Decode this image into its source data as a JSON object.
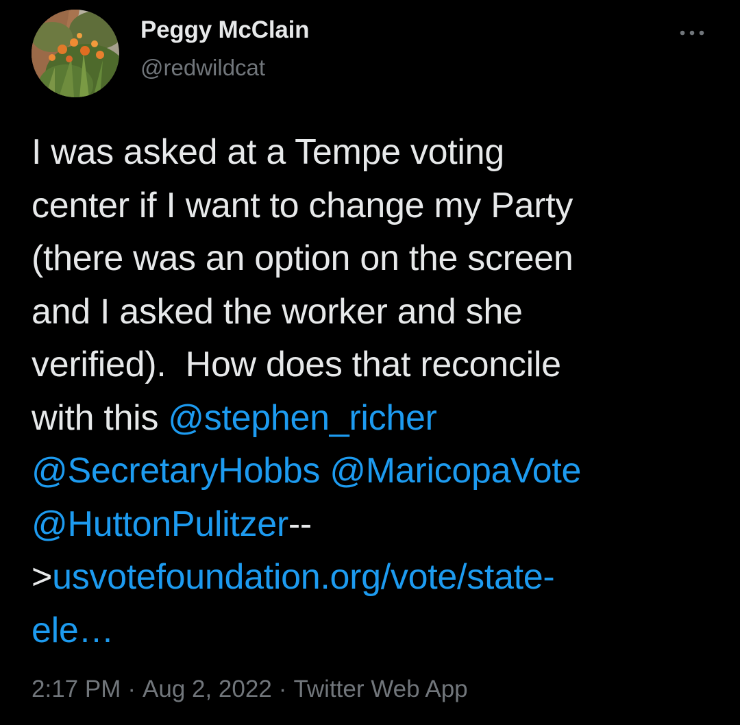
{
  "user": {
    "display_name": "Peggy McClain",
    "handle": "@redwildcat",
    "avatar_icon": "garden-flowers-avatar"
  },
  "menu": {
    "icon": "more-horizontal-icon"
  },
  "tweet": {
    "lines": [
      [
        {
          "text": "I was asked at a Tempe voting"
        }
      ],
      [
        {
          "text": "center if I want to change my Party"
        }
      ],
      [
        {
          "text": "(there was an option on the screen"
        }
      ],
      [
        {
          "text": "and I asked the worker and she"
        }
      ],
      [
        {
          "text": "verified).  How does that reconcile"
        }
      ],
      [
        {
          "text": "with this "
        },
        {
          "text": "@stephen_richer",
          "link": true
        }
      ],
      [
        {
          "text": "@SecretaryHobbs",
          "link": true
        },
        {
          "text": " "
        },
        {
          "text": "@MaricopaVote",
          "link": true
        }
      ],
      [
        {
          "text": "@HuttonPulitzer",
          "link": true
        },
        {
          "text": "--"
        }
      ],
      [
        {
          "text": ">"
        },
        {
          "text": "usvotefoundation.org/vote/state-",
          "link": true
        }
      ],
      [
        {
          "text": "ele…",
          "link": true
        }
      ]
    ]
  },
  "meta": {
    "time": "2:17 PM",
    "separator": "·",
    "date": "Aug 2, 2022",
    "source": "Twitter Web App"
  },
  "colors": {
    "background": "#000000",
    "text": "#e7e9ea",
    "secondary": "#71767b",
    "link": "#1d9bf0"
  }
}
